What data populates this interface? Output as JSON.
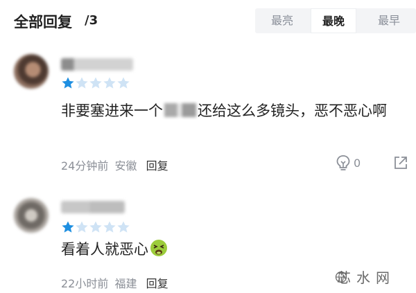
{
  "header": {
    "title": "全部回复",
    "count": "/3",
    "tabs": [
      "最亮",
      "最晚",
      "最早"
    ],
    "active_tab": "最晚"
  },
  "comments": [
    {
      "rating": 1,
      "max_rating": 5,
      "text_before": "非要塞进来一个",
      "text_after": "还给这么多镜头，恶不恶心啊",
      "time": "24分钟前",
      "location": "安徽",
      "reply_label": "回复",
      "likes": "0"
    },
    {
      "rating": 1,
      "max_rating": 5,
      "text": "看着人就恶心",
      "emoji": "nauseated-face",
      "time": "22小时前",
      "location": "福建",
      "reply_label": "回复"
    }
  ],
  "watermark": "芯水网",
  "colors": {
    "star_on": "#1e8fe1",
    "star_off": "#cfe3f5",
    "meta_gray": "#8b8f97",
    "tabs_bg": "#f3f4f6"
  }
}
